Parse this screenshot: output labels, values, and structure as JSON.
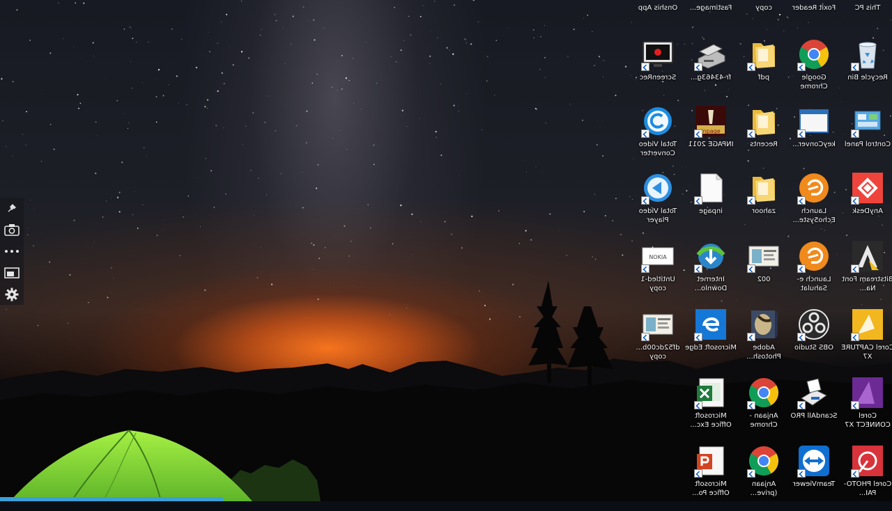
{
  "top_labels": [
    "Onshis App",
    "Fastimage...",
    "copy",
    "Foxit Reader",
    "This PC"
  ],
  "icons": [
    {
      "label": "ScreenRec",
      "icon": "screen-recorder-icon"
    },
    {
      "label": "fr-43463g...",
      "icon": "scanner-device-icon"
    },
    {
      "label": "pdf",
      "icon": "folder-icon"
    },
    {
      "label": "Google Chrome",
      "icon": "chrome-icon"
    },
    {
      "label": "Recycle Bin",
      "icon": "recycle-bin-icon"
    },
    {
      "label": "Total Video Converter",
      "icon": "video-converter-icon"
    },
    {
      "label": "INPAGE 2011",
      "icon": "inpage-icon"
    },
    {
      "label": "Recents",
      "icon": "folder-icon"
    },
    {
      "label": "keyConver...",
      "icon": "window-app-icon"
    },
    {
      "label": "Control Panel",
      "icon": "control-panel-icon"
    },
    {
      "label": "Total Video Player",
      "icon": "video-player-icon"
    },
    {
      "label": "inpage",
      "icon": "blank-file-icon"
    },
    {
      "label": "zahoor",
      "icon": "folder-icon"
    },
    {
      "label": "Launch Echo5yste...",
      "icon": "launcher-orange-icon"
    },
    {
      "label": "AnyDesk",
      "icon": "anydesk-icon"
    },
    {
      "label": "Untitled-1 copy",
      "icon": "image-file-icon"
    },
    {
      "label": "Internet Downlo...",
      "icon": "download-manager-icon"
    },
    {
      "label": "002",
      "icon": "photo-thumbnail-icon"
    },
    {
      "label": "Launch e-Sahulat",
      "icon": "launcher-orange-icon"
    },
    {
      "label": "Bitstream Font Na...",
      "icon": "font-app-icon"
    },
    {
      "label": "df52dc00b... copy",
      "icon": "photo-thumbnail-icon"
    },
    {
      "label": "Microsoft Edge",
      "icon": "edge-icon"
    },
    {
      "label": "Adobe Photosh...",
      "icon": "photoshop-icon"
    },
    {
      "label": "OBS Studio",
      "icon": "obs-icon"
    },
    {
      "label": "Corel CAPTURE X7",
      "icon": "corel-capture-icon"
    },
    {
      "label": "",
      "icon": "none"
    },
    {
      "label": "Microsoft Office Exc...",
      "icon": "excel-icon"
    },
    {
      "label": "Anjaan - Chrome",
      "icon": "chrome-icon"
    },
    {
      "label": "ScandAll PRO",
      "icon": "scanner-app-icon"
    },
    {
      "label": "Corel CONNECT X7",
      "icon": "corel-connect-icon"
    },
    {
      "label": "",
      "icon": "none"
    },
    {
      "label": "Microsoft Office Po...",
      "icon": "powerpoint-icon"
    },
    {
      "label": "Anjaan (prive...",
      "icon": "chrome-icon"
    },
    {
      "label": "TeamViewer",
      "icon": "teamviewer-icon"
    },
    {
      "label": "Corel PHOTO-PAI...",
      "icon": "corel-photo-icon"
    }
  ],
  "side_panel": [
    "pin-icon",
    "camera-icon",
    "more-dots-icon",
    "screen-capture-icon",
    "gear-icon"
  ]
}
